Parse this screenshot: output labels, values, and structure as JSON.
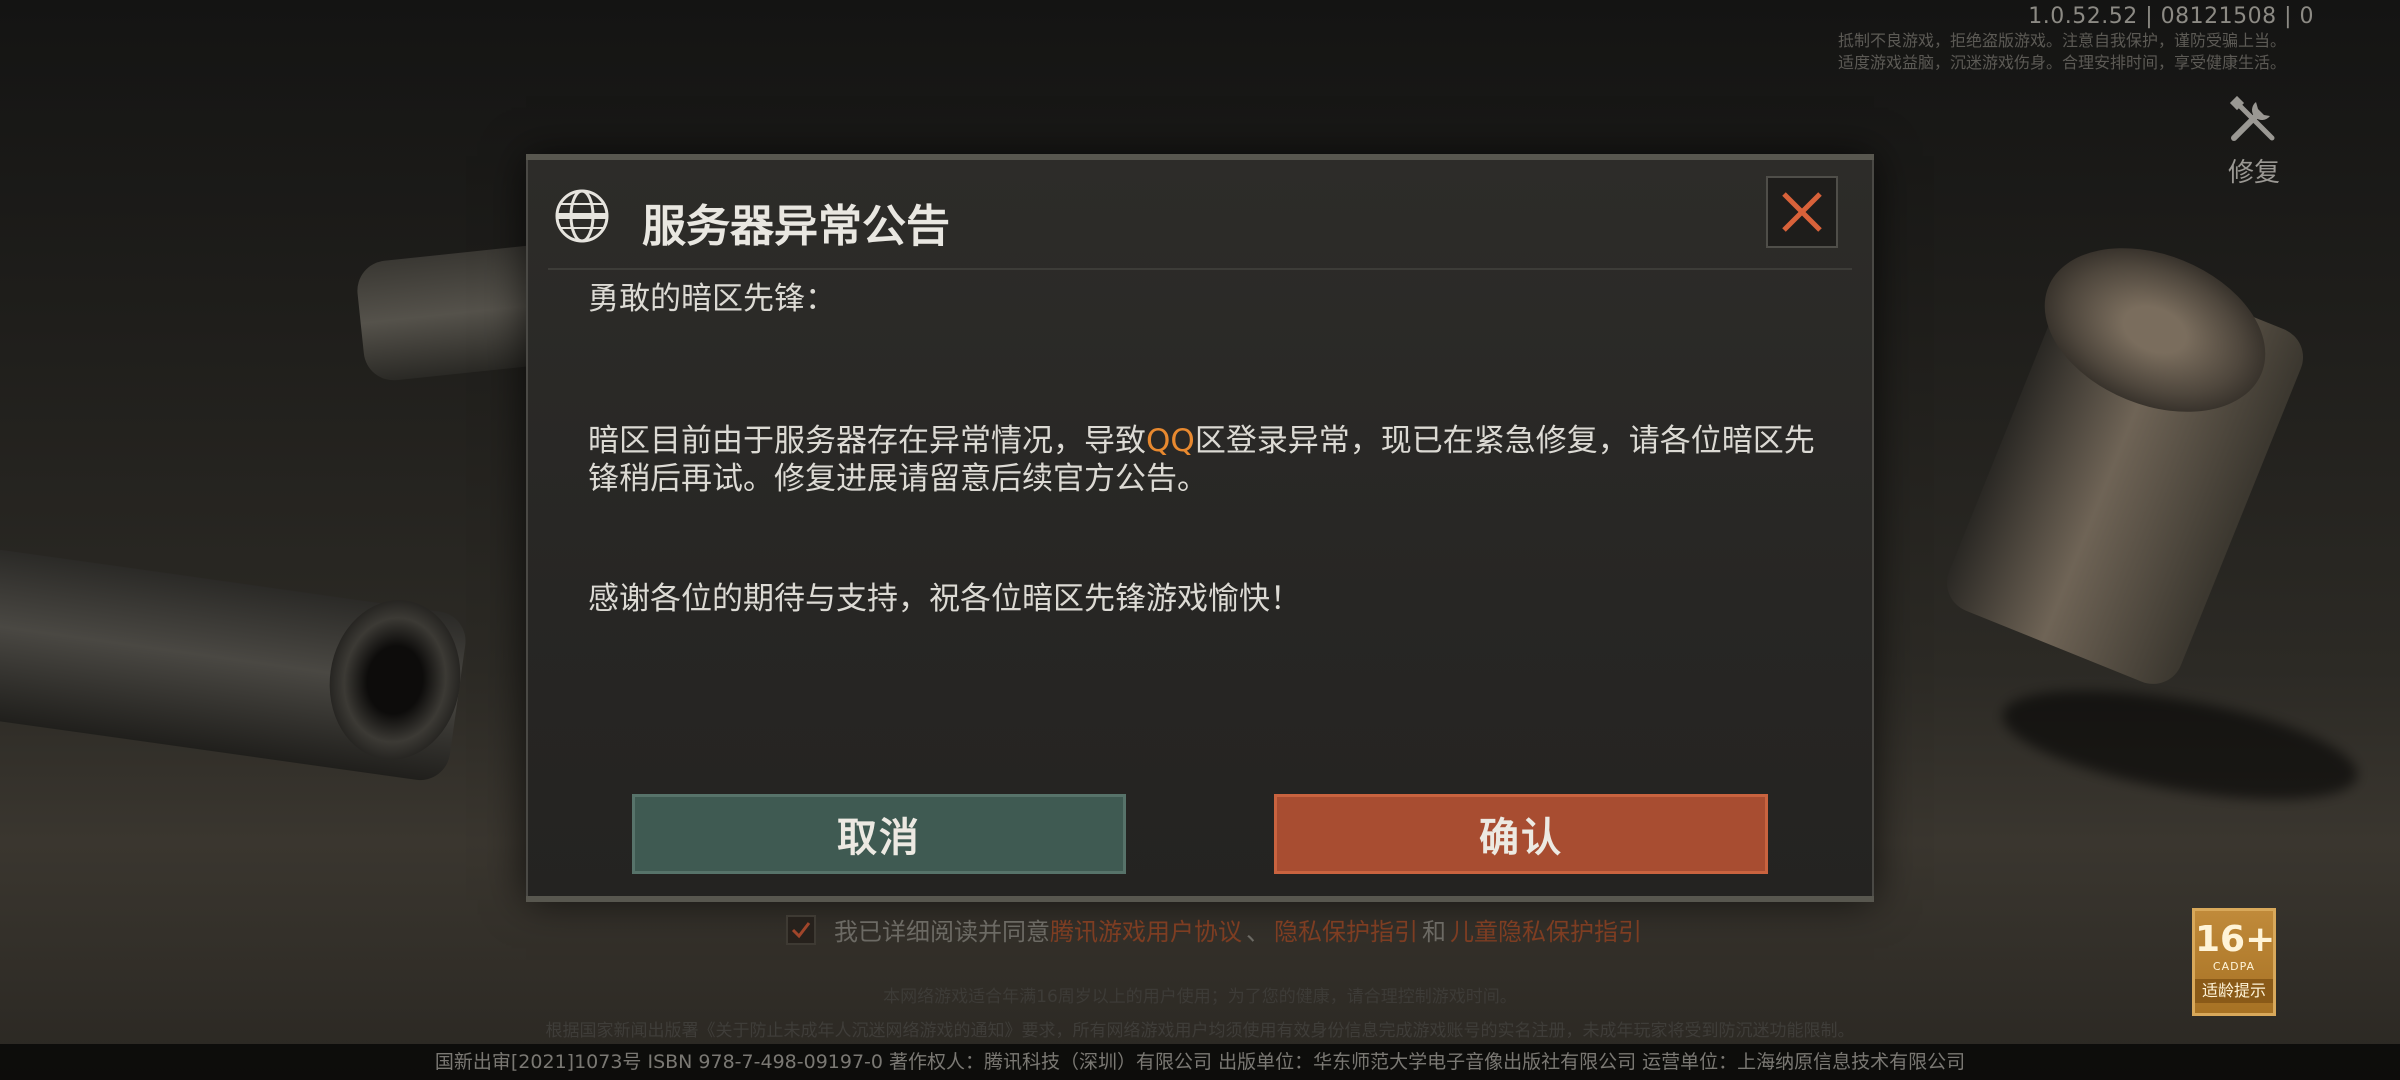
{
  "status": {
    "version": "1.0.52.52 | 08121508 | 0",
    "health_notice_line1": "抵制不良游戏，拒绝盗版游戏。注意自我保护，谨防受骗上当。",
    "health_notice_line2": "适度游戏益脑，沉迷游戏伤身。合理安排时间，享受健康生活。"
  },
  "repair": {
    "label": "修复",
    "icon": "wrench-screwdriver-icon"
  },
  "dialog": {
    "title": "服务器异常公告",
    "greeting": "勇敢的暗区先锋：",
    "para1_before": "暗区目前由于服务器存在异常情况，导致",
    "para1_highlight": "QQ",
    "para1_after": "区登录异常，现已在紧急修复，请各位暗区先锋稍后再试。修复进展请留意后续官方公告。",
    "para2": "感谢各位的期待与支持，祝各位暗区先锋游戏愉快！",
    "cancel_label": "取消",
    "confirm_label": "确认",
    "highlight_color": "#e8892f"
  },
  "agreement": {
    "prefix": "我已详细阅读并同意",
    "link1": "腾讯游戏用户协议",
    "sep1": "、",
    "link2": "隐私保护指引",
    "and": "和",
    "link3": "儿童隐私保护指引",
    "checked": true
  },
  "fine_print": {
    "line1": "本网络游戏适合年满16周岁以上的用户使用；为了您的健康，请合理控制游戏时间。",
    "line2": "根据国家新闻出版署《关于防止未成年人沉迷网络游戏的通知》要求，所有网络游戏用户均须使用有效身份信息完成游戏账号的实名注册，未成年玩家将受到防沉迷功能限制。"
  },
  "footer": "国新出审[2021]1073号  ISBN 978-7-498-09197-0  著作权人：腾讯科技（深圳）有限公司  出版单位：华东师范大学电子音像出版社有限公司  运营单位：上海纳原信息技术有限公司",
  "age_rating": {
    "number": "16+",
    "org": "CADPA",
    "tip": "适龄提示"
  }
}
